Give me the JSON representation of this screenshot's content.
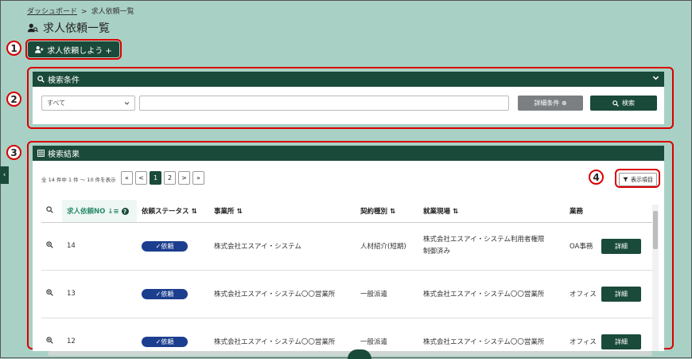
{
  "breadcrumb": {
    "home": "ダッシュボード",
    "separator": ">",
    "current": "求人依頼一覧"
  },
  "page_title": "求人依頼一覧",
  "markers": [
    "1",
    "2",
    "3",
    "4"
  ],
  "request_button": "求人依頼しよう +",
  "search_panel": {
    "title": "検索条件",
    "select_value": "すべて",
    "input_value": "",
    "detail_button": "詳細条件 ⊕",
    "search_button": "検索"
  },
  "results_panel": {
    "title": "検索結果",
    "pager_info": "全 14 件中 1 件 ～ 10 件を表示",
    "pager": [
      "«",
      "<",
      "1",
      "2",
      ">",
      "»"
    ],
    "pager_active": "1",
    "columns_button": "表示項目",
    "columns": [
      "求人依頼NO",
      "依頼ステータス",
      "事業所",
      "契約種別",
      "就業現場",
      "業務"
    ],
    "rows": [
      {
        "no": "14",
        "status": "✓依頼",
        "office": "株式会社エスアイ・システム",
        "contract": "人材紹介(短期)",
        "site_line1": "株式会社エスアイ・システム利用者権限",
        "site_line2": "制御済み",
        "work": "OA事務",
        "action": "詳細"
      },
      {
        "no": "13",
        "status": "✓依頼",
        "office": "株式会社エスアイ・システム〇〇営業所",
        "contract": "一般派遣",
        "site_line1": "株式会社エスアイ・システム〇〇営業所",
        "site_line2": "",
        "work": "オフィス",
        "action": "詳細"
      },
      {
        "no": "12",
        "status": "✓依頼",
        "office": "株式会社エスアイ・システム〇〇営業所",
        "contract": "一般派遣",
        "site_line1": "株式会社エスアイ・システム〇〇営業所",
        "site_line2": "",
        "work": "オフィス",
        "action": "詳細"
      }
    ]
  },
  "colors": {
    "background": "#a9d0c4",
    "primary": "#1a4a3a",
    "badge": "#1b3e8f",
    "marker": "#d90000"
  }
}
